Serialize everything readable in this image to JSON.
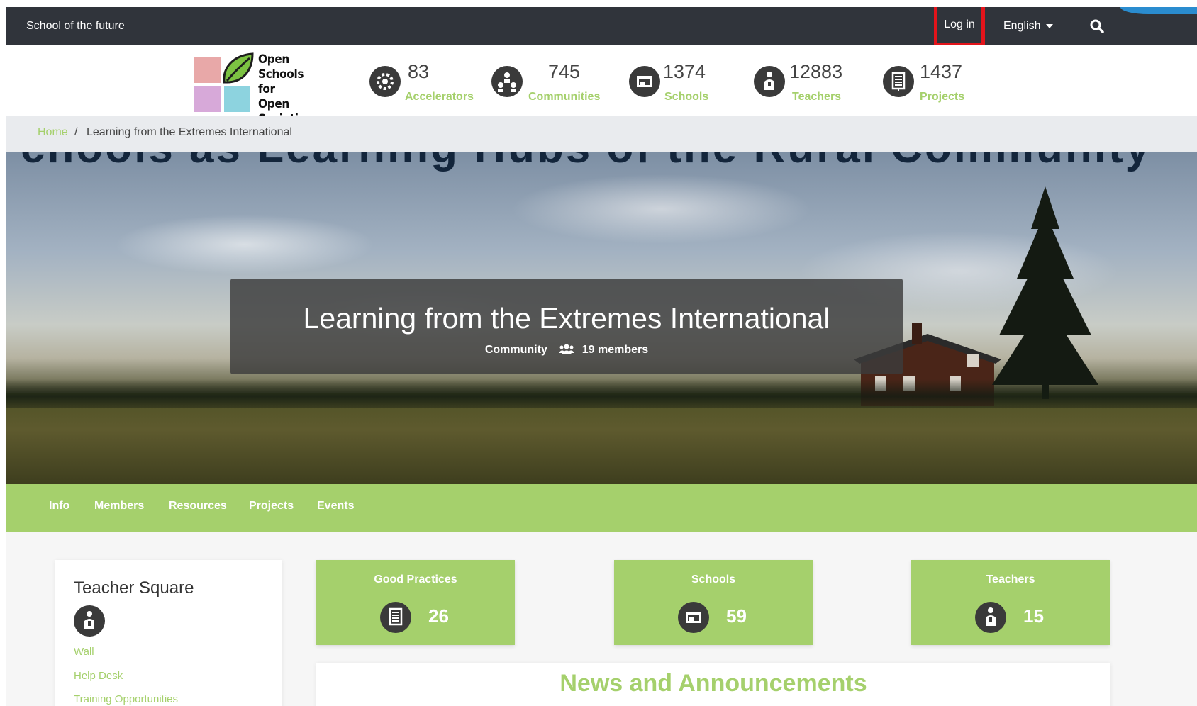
{
  "topbar": {
    "site_name": "School of the future",
    "login_label": "Log in",
    "language_label": "English",
    "search_icon": "search-icon"
  },
  "logo": {
    "lines": [
      "Open",
      "Schools for",
      "Open",
      "Societies"
    ],
    "colors": [
      "#e8a8a8",
      "#d7a9d9",
      "#8dd3df",
      "#6dbb3c"
    ]
  },
  "stats": [
    {
      "value": "83",
      "label": "Accelerators",
      "icon": "accelerator-icon"
    },
    {
      "value": "745",
      "label": "Communities",
      "icon": "communities-icon"
    },
    {
      "value": "1374",
      "label": "Schools",
      "icon": "school-icon"
    },
    {
      "value": "12883",
      "label": "Teachers",
      "icon": "teacher-icon"
    },
    {
      "value": "1437",
      "label": "Projects",
      "icon": "projects-icon"
    }
  ],
  "breadcrumb": {
    "home": "Home",
    "separator": "/",
    "current": "Learning from the Extremes International"
  },
  "hero": {
    "banner_text": "chools as Learning Hubs of the Rural Community",
    "title": "Learning from the Extremes International",
    "type": "Community",
    "members": "19 members"
  },
  "tabs": [
    "Info",
    "Members",
    "Resources",
    "Projects",
    "Events"
  ],
  "sidebar": {
    "title": "Teacher Square",
    "links": [
      "Wall",
      "Help Desk",
      "Training Opportunities"
    ]
  },
  "cards": [
    {
      "title": "Good Practices",
      "count": "26",
      "icon": "projects-icon"
    },
    {
      "title": "Schools",
      "count": "59",
      "icon": "school-icon"
    },
    {
      "title": "Teachers",
      "count": "15",
      "icon": "teacher-icon"
    }
  ],
  "news": {
    "title": "News and Announcements"
  },
  "colors": {
    "accent": "#a5d06c",
    "topbar": "#30343b",
    "login_highlight": "#e3141b"
  }
}
